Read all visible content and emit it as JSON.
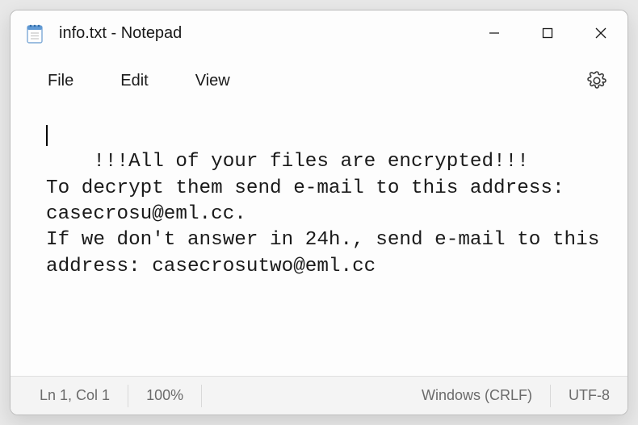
{
  "titlebar": {
    "title": "info.txt - Notepad"
  },
  "menu": {
    "file": "File",
    "edit": "Edit",
    "view": "View"
  },
  "editor": {
    "content": "!!!All of your files are encrypted!!!\nTo decrypt them send e-mail to this address: casecrosu@eml.cc.\nIf we don't answer in 24h., send e-mail to this address: casecrosutwo@eml.cc"
  },
  "statusbar": {
    "position": "Ln 1, Col 1",
    "zoom": "100%",
    "line_ending": "Windows (CRLF)",
    "encoding": "UTF-8"
  }
}
